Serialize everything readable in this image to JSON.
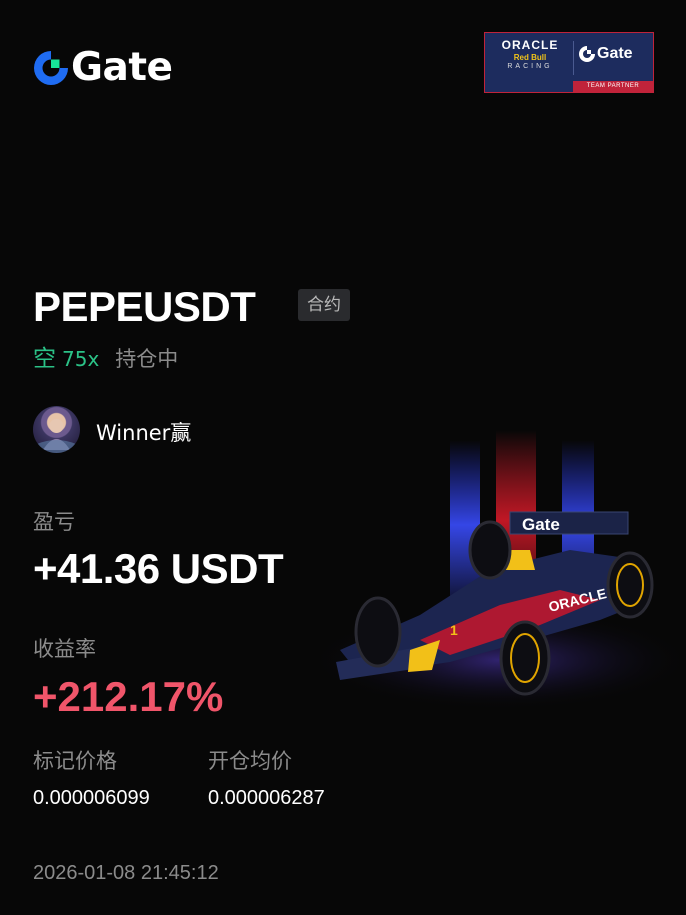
{
  "brand": {
    "name": "Gate",
    "icon": "gate-logo-icon",
    "accent": "#1f6cf2",
    "accent2": "#17e59a"
  },
  "partner": {
    "oracle": "ORACLE",
    "red_bull": "Red Bull",
    "racing": "RACING",
    "gate": "Gate",
    "footer": "TEAM PARTNER"
  },
  "position": {
    "symbol": "PEPEUSDT",
    "type_badge": "合约",
    "side": "空",
    "leverage": "75x",
    "status": "持仓中",
    "side_color": "#2bc287"
  },
  "user": {
    "name": "Winner赢",
    "avatar": "avatar-image"
  },
  "pnl": {
    "label": "盈亏",
    "value": "+41.36 USDT"
  },
  "roi": {
    "label": "收益率",
    "value": "+212.17%",
    "color": "#f0556a"
  },
  "prices": {
    "mark_label": "标记价格",
    "mark_value": "0.000006099",
    "entry_label": "开仓均价",
    "entry_value": "0.000006287"
  },
  "timestamp": "2026-01-08 21:45:12",
  "car_livery": {
    "text": "ORACLE",
    "wing_text": "Gate",
    "number": "1"
  }
}
